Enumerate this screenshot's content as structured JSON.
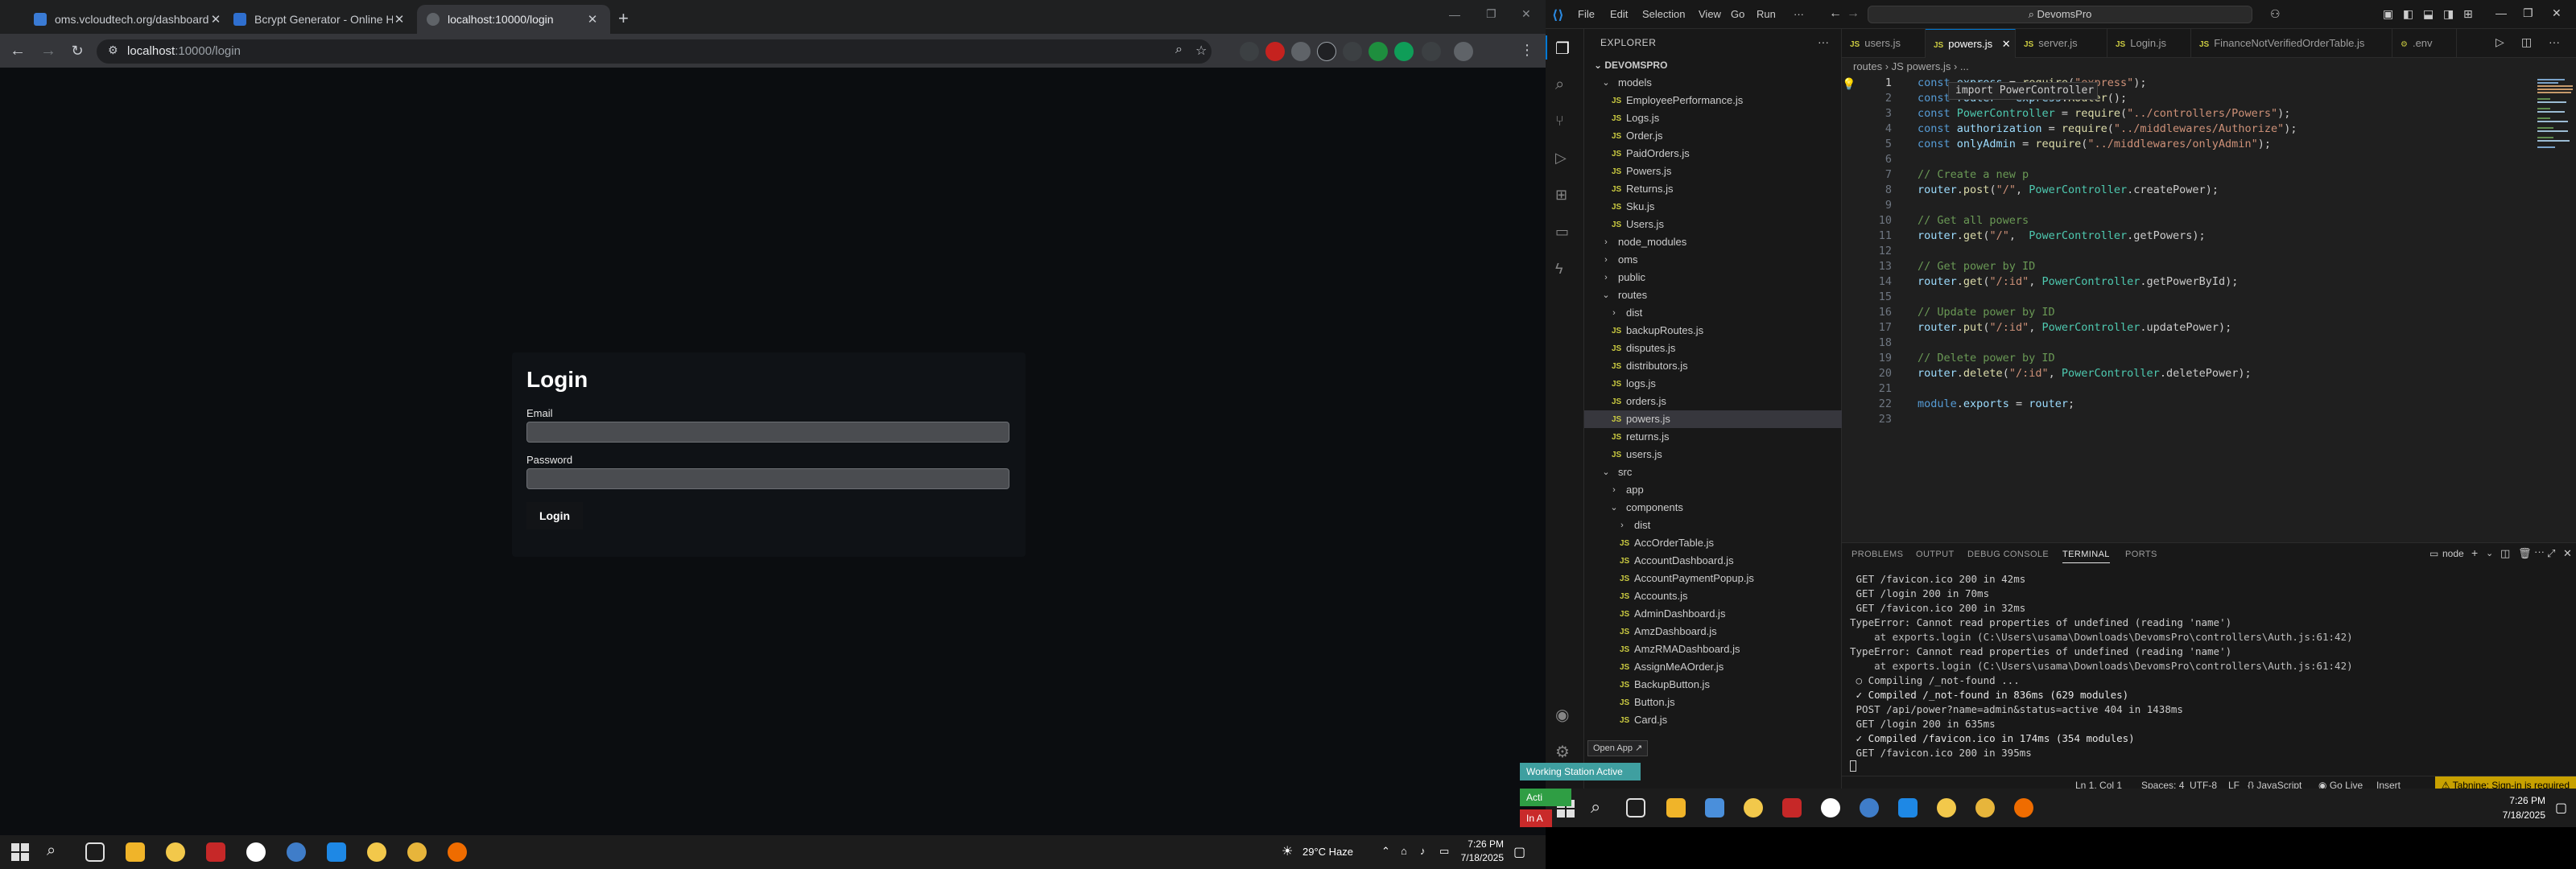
{
  "browser": {
    "tabs": [
      {
        "label": "oms.vcloudtech.org/dashboard",
        "active": false
      },
      {
        "label": "Bcrypt Generator - Online Hash",
        "active": false
      },
      {
        "label": "localhost:10000/login",
        "active": true
      }
    ],
    "new_tab": "+",
    "url_host": "localhost",
    "url_path": ":10000/login"
  },
  "login": {
    "title": "Login",
    "email_label": "Email",
    "email_value": "",
    "password_label": "Password",
    "password_value": "",
    "button": "Login"
  },
  "taskbar_left": {
    "weather": "29°C  Haze",
    "time": "7:26 PM",
    "date": "7/18/2025"
  },
  "vscode": {
    "menu": [
      "File",
      "Edit",
      "Selection",
      "View",
      "Go",
      "Run",
      "···"
    ],
    "command_center": "DevomsPro",
    "explorer_title": "EXPLORER",
    "project": "DEVOMSPRO",
    "tree": [
      {
        "name": "models",
        "type": "folder-open",
        "depth": 1
      },
      {
        "name": "EmployeePerformance.js",
        "type": "file",
        "depth": 2
      },
      {
        "name": "Logs.js",
        "type": "file",
        "depth": 2
      },
      {
        "name": "Order.js",
        "type": "file",
        "depth": 2
      },
      {
        "name": "PaidOrders.js",
        "type": "file",
        "depth": 2
      },
      {
        "name": "Powers.js",
        "type": "file",
        "depth": 2
      },
      {
        "name": "Returns.js",
        "type": "file",
        "depth": 2
      },
      {
        "name": "Sku.js",
        "type": "file",
        "depth": 2
      },
      {
        "name": "Users.js",
        "type": "file",
        "depth": 2
      },
      {
        "name": "node_modules",
        "type": "folder",
        "depth": 1
      },
      {
        "name": "oms",
        "type": "folder",
        "depth": 1
      },
      {
        "name": "public",
        "type": "folder",
        "depth": 1
      },
      {
        "name": "routes",
        "type": "folder-open",
        "depth": 1
      },
      {
        "name": "dist",
        "type": "folder",
        "depth": 2
      },
      {
        "name": "backupRoutes.js",
        "type": "file",
        "depth": 2
      },
      {
        "name": "disputes.js",
        "type": "file",
        "depth": 2
      },
      {
        "name": "distributors.js",
        "type": "file",
        "depth": 2
      },
      {
        "name": "logs.js",
        "type": "file",
        "depth": 2
      },
      {
        "name": "orders.js",
        "type": "file",
        "depth": 2
      },
      {
        "name": "powers.js",
        "type": "file",
        "depth": 2,
        "selected": true
      },
      {
        "name": "returns.js",
        "type": "file",
        "depth": 2
      },
      {
        "name": "users.js",
        "type": "file",
        "depth": 2
      },
      {
        "name": "src",
        "type": "folder-open",
        "depth": 1
      },
      {
        "name": "app",
        "type": "folder",
        "depth": 2
      },
      {
        "name": "components",
        "type": "folder-open",
        "depth": 2
      },
      {
        "name": "dist",
        "type": "folder",
        "depth": 3
      },
      {
        "name": "AccOrderTable.js",
        "type": "file",
        "depth": 3
      },
      {
        "name": "AccountDashboard.js",
        "type": "file",
        "depth": 3
      },
      {
        "name": "AccountPaymentPopup.js",
        "type": "file",
        "depth": 3
      },
      {
        "name": "Accounts.js",
        "type": "file",
        "depth": 3
      },
      {
        "name": "AdminDashboard.js",
        "type": "file",
        "depth": 3
      },
      {
        "name": "AmzDashboard.js",
        "type": "file",
        "depth": 3
      },
      {
        "name": "AmzRMADashboard.js",
        "type": "file",
        "depth": 3
      },
      {
        "name": "AssignMeAOrder.js",
        "type": "file",
        "depth": 3
      },
      {
        "name": "BackupButton.js",
        "type": "file",
        "depth": 3
      },
      {
        "name": "Button.js",
        "type": "file",
        "depth": 3
      },
      {
        "name": "Card.js",
        "type": "file",
        "depth": 3
      }
    ],
    "editor_tabs": [
      {
        "label": "users.js",
        "active": false
      },
      {
        "label": "powers.js",
        "active": true
      },
      {
        "label": "server.js",
        "active": false
      },
      {
        "label": "Login.js",
        "active": false
      },
      {
        "label": "FinanceNotVerifiedOrderTable.js",
        "active": false
      },
      {
        "label": ".env",
        "active": false
      }
    ],
    "breadcrumb": "routes  ›  JS powers.js  ›  ...",
    "hover_hint": "import PowerController",
    "code": [
      "const express = require(\"express\");",
      "const router = express.Router();",
      "const PowerController = require(\"../controllers/Powers\");",
      "const authorization = require(\"../middlewares/Authorize\");",
      "const onlyAdmin = require(\"../middlewares/onlyAdmin\");",
      "",
      "// Create a new p",
      "router.post(\"/\", PowerController.createPower);",
      "",
      "// Get all powers",
      "router.get(\"/\",  PowerController.getPowers);",
      "",
      "// Get power by ID",
      "router.get(\"/:id\", PowerController.getPowerById);",
      "",
      "// Update power by ID",
      "router.put(\"/:id\", PowerController.updatePower);",
      "",
      "// Delete power by ID",
      "router.delete(\"/:id\", PowerController.deletePower);",
      "",
      "module.exports = router;",
      ""
    ],
    "panel_tabs": [
      "PROBLEMS",
      "OUTPUT",
      "DEBUG CONSOLE",
      "TERMINAL",
      "PORTS"
    ],
    "terminal_label": "node",
    "terminal": [
      " GET /favicon.ico 200 in 42ms",
      " GET /login 200 in 70ms",
      " GET /favicon.ico 200 in 32ms",
      "TypeError: Cannot read properties of undefined (reading 'name')",
      "    at exports.login (C:\\Users\\usama\\Downloads\\DevomsPro\\controllers\\Auth.js:61:42)",
      "TypeError: Cannot read properties of undefined (reading 'name')",
      "    at exports.login (C:\\Users\\usama\\Downloads\\DevomsPro\\controllers\\Auth.js:61:42)",
      " ○ Compiling /_not-found ...",
      " ✓ Compiled /_not-found in 836ms (629 modules)",
      " POST /api/power?name=admin&status=active 404 in 1438ms",
      " GET /login 200 in 635ms",
      " ✓ Compiled /favicon.ico in 174ms (354 modules)",
      " GET /favicon.ico 200 in 395ms"
    ],
    "status": {
      "position": "Ln 1, Col 1",
      "spaces": "Spaces: 4",
      "encoding": "UTF-8",
      "eol": "LF",
      "language": "{} JavaScript",
      "golive": "Go Live",
      "insert": "Insert",
      "tabnine": "Tabnine: Sign-in is required"
    },
    "open_app": "Open App ↗",
    "notif_working": "Working Station Active",
    "notif_act": "Acti",
    "notif_in": "In A",
    "taskbar_time": "7:26 PM",
    "taskbar_date": "7/18/2025"
  }
}
